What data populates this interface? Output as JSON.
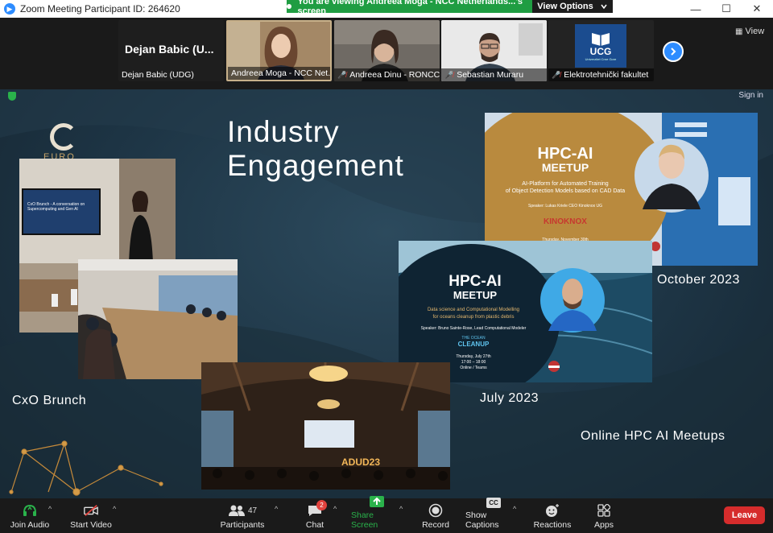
{
  "window": {
    "title": "Zoom Meeting Participant ID: 264620",
    "share_banner": "You are viewing Andreea Moga - NCC Netherlands...'s screen",
    "view_options": "View Options",
    "minimize": "—",
    "maximize": "☐",
    "close": "✕"
  },
  "gallery": {
    "view_label": "View",
    "next_icon": "chevron-right-icon",
    "tiles": [
      {
        "big_name": "Dejan Babic (U...",
        "label": "Dejan Babic (UDG)",
        "muted": false
      },
      {
        "label": "Andreea Moga - NCC Net...",
        "muted": false
      },
      {
        "label": "Andreea Dinu - RONCC",
        "muted": true
      },
      {
        "label": "Sebastian Muraru",
        "muted": true
      },
      {
        "label": "Elektrotehnički fakultet",
        "muted": true,
        "logo_text": "UCG",
        "logo_sub": "Univerzitet Crne Gore"
      }
    ]
  },
  "slide": {
    "sign_in": "Sign in",
    "logo_text": "EURO",
    "title_line1": "Industry",
    "title_line2": "Engagement",
    "captions": {
      "cxo": "CxO Brunch",
      "october": "October 2023",
      "july": "July 2023",
      "online": "Online HPC AI Meetups"
    },
    "poster_oct": {
      "title1": "HPC-AI",
      "title2": "MEETUP",
      "subtitle1": "AI-Platform for Automated Training",
      "subtitle2": "of Object Detection Models based on CAD Data",
      "speaker": "Speaker: Lukas Kriele CEO Kinoknox UG",
      "brand": "KINOKNOX",
      "date": "Thursday, November 30th"
    },
    "poster_jul": {
      "title1": "HPC-AI",
      "title2": "MEETUP",
      "subtitle1": "Data science and Computational Modelling",
      "subtitle2": "for oceans cleanup from plastic debris",
      "speaker": "Speaker: Bruno Sainte-Rose, Lead Computational Modeler",
      "brand_small": "THE OCEAN",
      "brand": "CLEANUP",
      "date1": "Thursday, July 27th",
      "date2": "17:00 – 18:00",
      "date3": "Online / Teams"
    },
    "cxo_screen_text": "CxO Brunch - A conversation on Supercomputing and Gen AI",
    "hall_sign": "ADUD23"
  },
  "toolbar": {
    "join_audio": "Join Audio",
    "start_video": "Start Video",
    "participants": "Participants",
    "participants_count": "47",
    "chat": "Chat",
    "chat_badge": "2",
    "share_screen": "Share Screen",
    "record": "Record",
    "show_captions": "Show Captions",
    "captions_icon_text": "CC",
    "reactions": "Reactions",
    "apps": "Apps",
    "leave": "Leave",
    "caret": "^"
  }
}
